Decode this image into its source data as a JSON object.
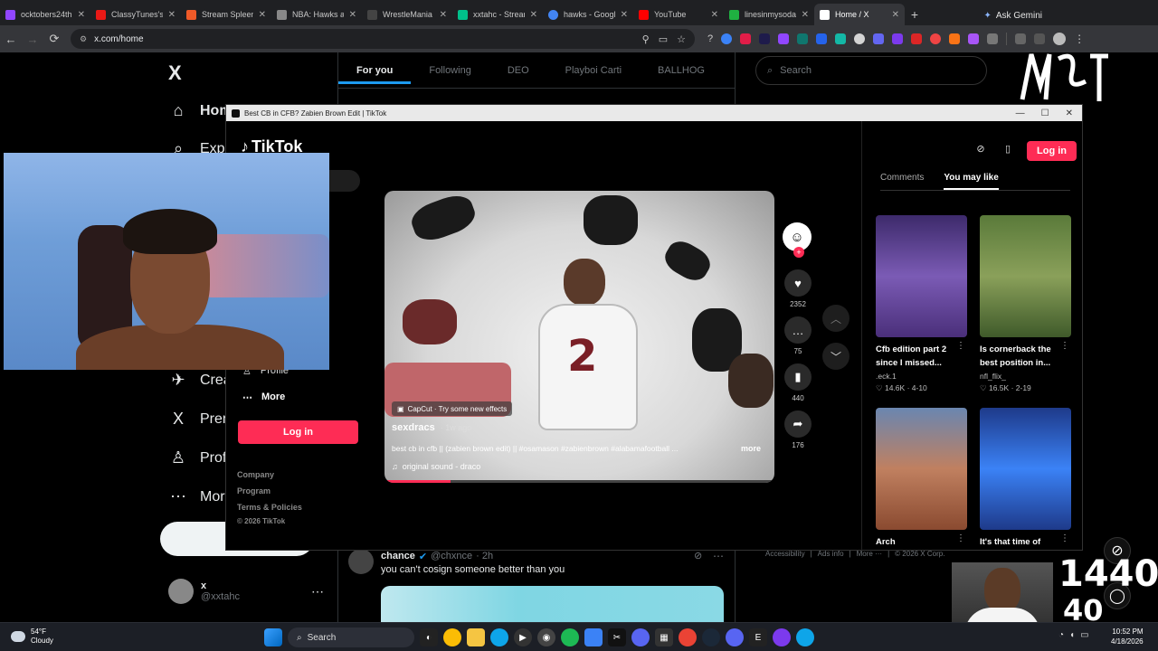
{
  "browser": {
    "tabs": [
      {
        "label": "ocktobers24th",
        "color": "#9146ff"
      },
      {
        "label": "ClassyTunes's",
        "color": "#e91916"
      },
      {
        "label": "Stream Spleen",
        "color": "#f05a28"
      },
      {
        "label": "NBA: Hawks at",
        "color": "#888888"
      },
      {
        "label": "WrestleMania",
        "color": "#222222"
      },
      {
        "label": "xxtahc - Strean",
        "color": "#00c08b"
      },
      {
        "label": "hawks - Googl",
        "color": "#4285f4"
      },
      {
        "label": "YouTube",
        "color": "#ff0000"
      },
      {
        "label": "linesinmysoda",
        "color": "#1fb141"
      },
      {
        "label": "Home / X",
        "color": "#ffffff"
      }
    ],
    "new_tab": "+",
    "gemini_label": "Ask Gemini",
    "url": "x.com/home",
    "back": "←",
    "forward": "→",
    "reload": "⟳",
    "close_glyph": "✕"
  },
  "x": {
    "logo": "X",
    "nav": [
      {
        "icon": "⌂",
        "label": "Home",
        "bold": true
      },
      {
        "icon": "⌕",
        "label": "Expl"
      },
      {
        "icon": "✈",
        "label": "Crea"
      },
      {
        "icon": "X",
        "label": "Prem"
      },
      {
        "icon": "♙",
        "label": "Profi"
      },
      {
        "icon": "⋯",
        "label": "More"
      }
    ],
    "feed_tabs": [
      "For you",
      "Following",
      "DEO",
      "Playboi Carti",
      "BALLHOG"
    ],
    "search_placeholder": "Search",
    "account": {
      "name": "x",
      "handle": "@xxtahc",
      "menu": "⋯"
    },
    "tweet": {
      "name": "chance",
      "handle": "@chxnce",
      "time": "· 2h",
      "text": "you can't cosign someone better than you",
      "menu": "⋯"
    },
    "footer": [
      "Accessibility",
      "|",
      "Ads info",
      "|",
      "More ···",
      "|",
      "© 2026 X Corp."
    ]
  },
  "tiktok": {
    "window_title": "Best CB in CFB? Zabien Brown Edit | TikTok",
    "window_buttons": [
      "—",
      "☐",
      "✕"
    ],
    "logo": "TikTok",
    "left": {
      "profile": "Profile",
      "more": "More",
      "login": "Log in",
      "footer": [
        "Company",
        "Program",
        "Terms & Policies",
        "© 2026 TikTok"
      ]
    },
    "video": {
      "jersey_number": "2",
      "capcut": "CapCut · Try some new effects",
      "username": "sexdracs",
      "age": "· 1w ago",
      "description": "best cb in cfb || (zabien brown edit) || #osamason #zabienbrown #alabamafootball ...",
      "more": "more",
      "sound": "original sound - draco",
      "progress": 0.17
    },
    "actions": [
      {
        "icon": "♥",
        "count": "2352"
      },
      {
        "icon": "…",
        "count": "75"
      },
      {
        "icon": "▮",
        "count": "440"
      },
      {
        "icon": "➦",
        "count": "176"
      }
    ],
    "right": {
      "login": "Log in",
      "tabs": [
        "Comments",
        "You may like"
      ],
      "cards": [
        {
          "title": "Cfb edition part 2 since I missed...",
          "author": ".eck.1",
          "likes": "♡ 14.6K",
          "date": "4-10"
        },
        {
          "title": "Is cornerback the best position in...",
          "author": "nfl_flix_",
          "likes": "♡ 16.5K",
          "date": "2-19"
        },
        {
          "title": "Arch",
          "author": "",
          "likes": "",
          "date": ""
        },
        {
          "title": "It's that time of",
          "author": "",
          "likes": "",
          "date": ""
        }
      ]
    }
  },
  "overlay": {
    "counter_top": "1440",
    "counter_bottom": "40"
  },
  "taskbar": {
    "weather_temp": "54°F",
    "weather_desc": "Cloudy",
    "search": "Search",
    "time": "10:52 PM",
    "date": "4/18/2026"
  }
}
